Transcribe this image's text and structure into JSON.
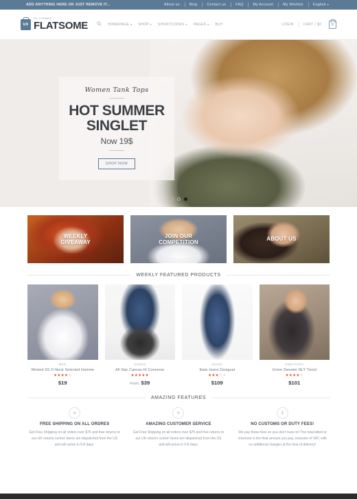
{
  "topbar": {
    "promo": "ADD ANYTHING HERE OR JUST REMOVE IT...",
    "links": [
      "About us",
      "Blog",
      "Contact us",
      "FAQ",
      "My Account",
      "My Wishlist"
    ],
    "language": "English"
  },
  "header": {
    "logo": {
      "mark": "UX",
      "sup": "UX THEMES",
      "name": "FLATSOME"
    },
    "search_icon": "search-icon",
    "nav": [
      {
        "label": "HOMEPAGE",
        "has_dropdown": true
      },
      {
        "label": "SHOP",
        "has_dropdown": true
      },
      {
        "label": "SHORTCODES",
        "has_dropdown": true
      },
      {
        "label": "PAGES",
        "has_dropdown": true
      },
      {
        "label": "BUY",
        "has_dropdown": false
      }
    ],
    "login": "LOGIN",
    "cart": "CART / $0",
    "cart_count": "0"
  },
  "hero": {
    "script": "Women Tank Tops",
    "headline": "HOT SUMMER SINGLET",
    "subline": "Now 19$",
    "button": "SHOP NOW",
    "slides": 3,
    "active_slide": 3
  },
  "banners": [
    {
      "label": "WEEKLY\nGIVEAWAY",
      "line1": "WEEKLY",
      "line2": "GIVEAWAY"
    },
    {
      "label": "JOIN OUR\nCOMPETITION",
      "line1": "JOIN OUR",
      "line2": "COMPETITION"
    },
    {
      "label": "ABOUT US",
      "line1": "ABOUT US",
      "line2": ""
    }
  ],
  "products_section": {
    "title": "WEEKLY FEATURED PRODUCTS"
  },
  "products": [
    {
      "category": "MEN",
      "name": "Wicked SS O-Neck Selected Homme",
      "rating": 4,
      "price": "$19",
      "price_prefix": ""
    },
    {
      "category": "SHOES",
      "name": "All Star Canvas HI Converse",
      "rating": 5,
      "price": "$39",
      "price_prefix": "From:"
    },
    {
      "category": "JEANS",
      "name": "Ikats Jeans Desigual",
      "rating": 3,
      "price": "$109",
      "price_prefix": ""
    },
    {
      "category": "SWEATERS",
      "name": "Union Sweater NLY Trend",
      "rating": 4,
      "price": "$101",
      "price_prefix": ""
    }
  ],
  "features_section": {
    "title": "AMAZING FEATURES"
  },
  "features": [
    {
      "icon": "star-icon",
      "glyph": "★",
      "title": "FREE SHIPPING ON ALL ORDRES",
      "body": "Get Free Shipping on all orders over $75 and free returns to our UK returns centre! Items are dispatched from the US and will arrive in 5-8 days."
    },
    {
      "icon": "heart-icon",
      "glyph": "♥",
      "title": "AMAZING CUSTOMER SERVICE",
      "body": "Get Free Shipping on all orders over $75 and free returns to our UK returns centre! Items are dispatched from the US and will arrive in 5-8 days."
    },
    {
      "icon": "download-icon",
      "glyph": "⬇",
      "title": "NO CUSTOMS OR DUTY FEES!",
      "body": "We pay these fees so you don't have to! The total billed at checkout is the final amount you pay, inclusive of VAT, with no additional charges at the time of delivery!"
    }
  ],
  "colors": {
    "topbar_bg": "#5b7a96",
    "accent": "#5b7a96",
    "star": "#d8502a",
    "text_dark": "#3b4046",
    "text_muted": "#8f959c"
  }
}
